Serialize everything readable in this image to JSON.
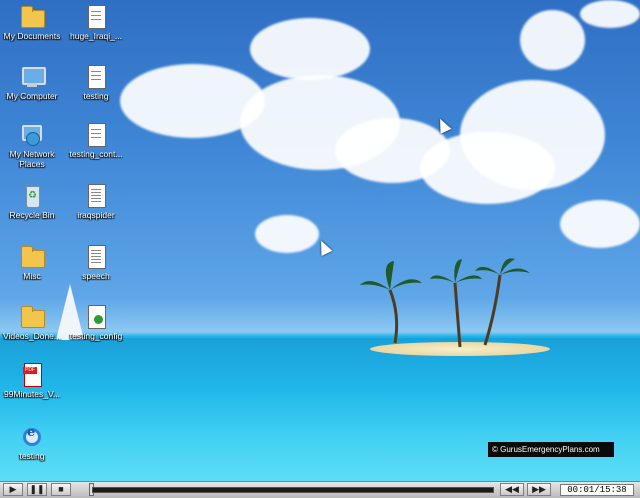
{
  "desktop": {
    "icons": [
      {
        "label": "My Documents"
      },
      {
        "label": "huge_Iraqi_..."
      },
      {
        "label": "My Computer"
      },
      {
        "label": "testing"
      },
      {
        "label": "My Network Places"
      },
      {
        "label": "testing_cont..."
      },
      {
        "label": "Recycle Bin"
      },
      {
        "label": "iraqspider"
      },
      {
        "label": "Misc"
      },
      {
        "label": "speech"
      },
      {
        "label": "Videos_Done..."
      },
      {
        "label": "testing_config"
      },
      {
        "label": "99Minutes_V..."
      },
      {
        "label": "testing"
      }
    ],
    "watermark": "© GurusEmergencyPlans.com"
  },
  "player": {
    "play_label": "▶",
    "pause_label": "❚❚",
    "stop_label": "■",
    "rewind_label": "◀◀",
    "forward_label": "▶▶",
    "time": "00:01/15:38",
    "progress": 0.0
  }
}
